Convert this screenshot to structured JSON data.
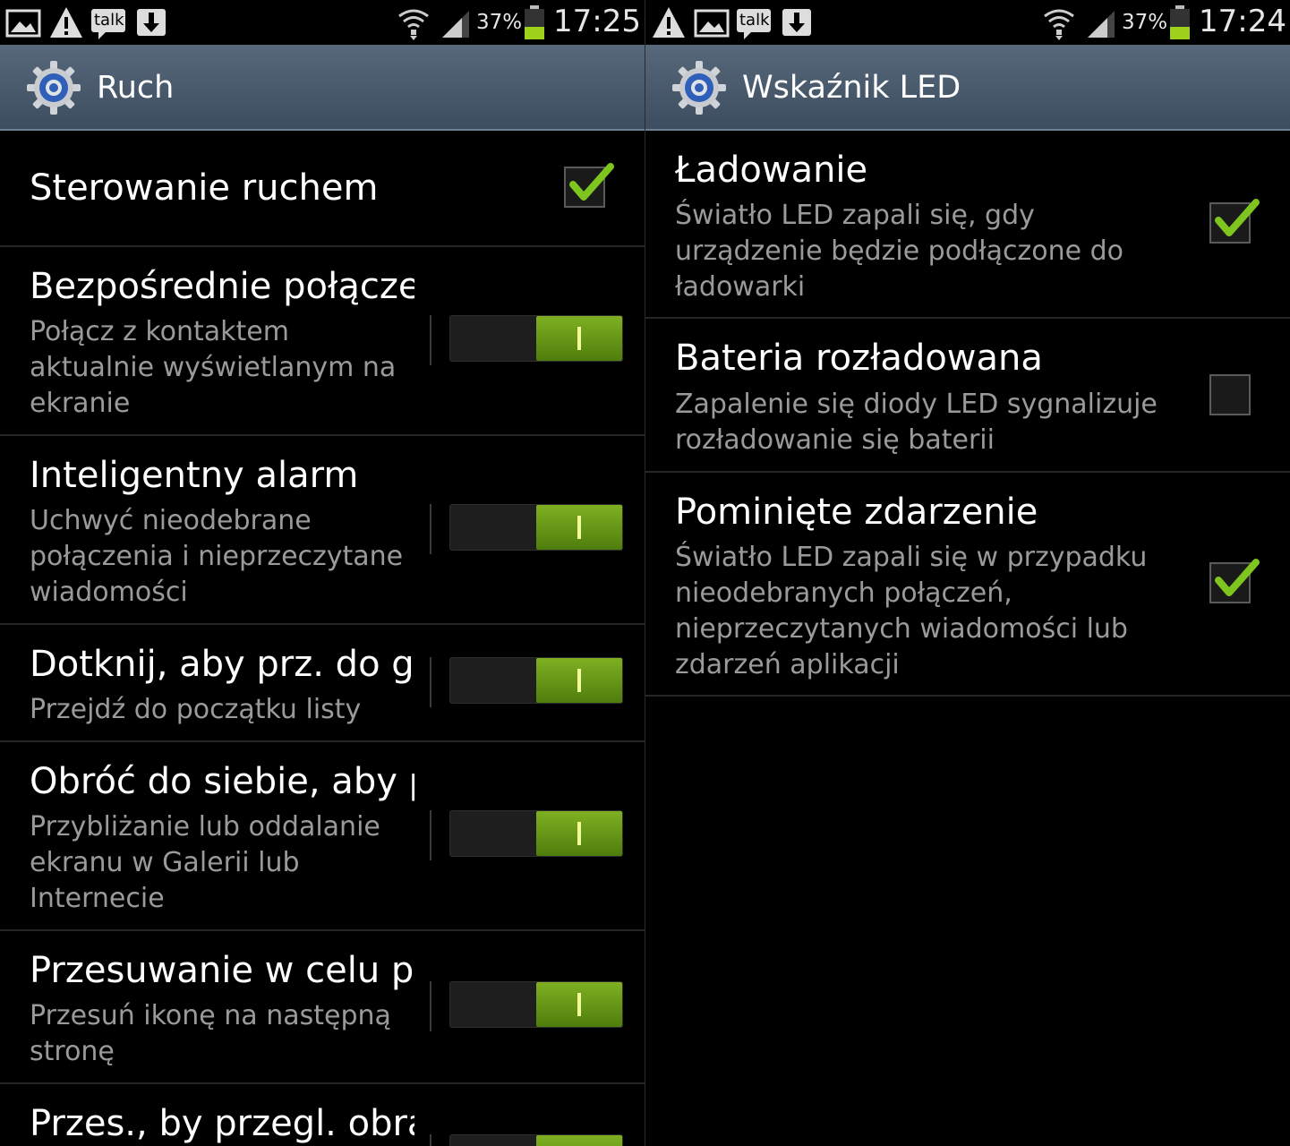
{
  "left": {
    "status": {
      "battery": "37%",
      "clock": "17:25",
      "talk_label": "talk"
    },
    "title": "Ruch",
    "items": [
      {
        "title": "Sterowanie ruchem",
        "checked": true
      },
      {
        "title": "Bezpośrednie połącze",
        "subtitle_lines": [
          "Połącz z kontaktem",
          "aktualnie wyświetlanym na",
          "ekranie"
        ],
        "switch_on": true
      },
      {
        "title": "Inteligentny alarm",
        "subtitle_lines": [
          "Uchwyć nieodebrane",
          "połączenia i nieprzeczytane",
          "wiadomości"
        ],
        "switch_on": true
      },
      {
        "title": "Dotknij, aby prz. do gó",
        "subtitle_lines": [
          "Przejdź do początku listy"
        ],
        "switch_on": true
      },
      {
        "title": "Obróć do siebie, aby p",
        "subtitle_lines": [
          "Przybliżanie lub oddalanie",
          "ekranu w Galerii lub",
          "Internecie"
        ],
        "switch_on": true
      },
      {
        "title": "Przesuwanie w celu p",
        "subtitle_lines": [
          "Przesuń ikonę na następną",
          "stronę"
        ],
        "switch_on": true
      },
      {
        "title": "Przes., by przegl. obra",
        "subtitle_lines": [],
        "switch_on": true
      }
    ]
  },
  "right": {
    "status": {
      "battery": "37%",
      "clock": "17:24",
      "talk_label": "talk"
    },
    "title": "Wskaźnik LED",
    "items": [
      {
        "title": "Ładowanie",
        "subtitle_lines": [
          "Światło LED zapali się, gdy",
          "urządzenie będzie podłączone do",
          "ładowarki"
        ],
        "checked": true
      },
      {
        "title": "Bateria rozładowana",
        "subtitle_lines": [
          "Zapalenie się diody LED sygnalizuje",
          "rozładowanie się baterii"
        ],
        "checked": false
      },
      {
        "title": "Pominięte zdarzenie",
        "subtitle_lines": [
          "Światło LED zapali się w przypadku",
          "nieodebranych połączeń,",
          "nieprzeczytanych wiadomości lub",
          "zdarzeń aplikacji"
        ],
        "checked": true
      }
    ]
  },
  "colors": {
    "accent_green": "#7ec51f",
    "title_bar": "#4a5b6d",
    "subtitle_gray": "#9a9a9a"
  }
}
